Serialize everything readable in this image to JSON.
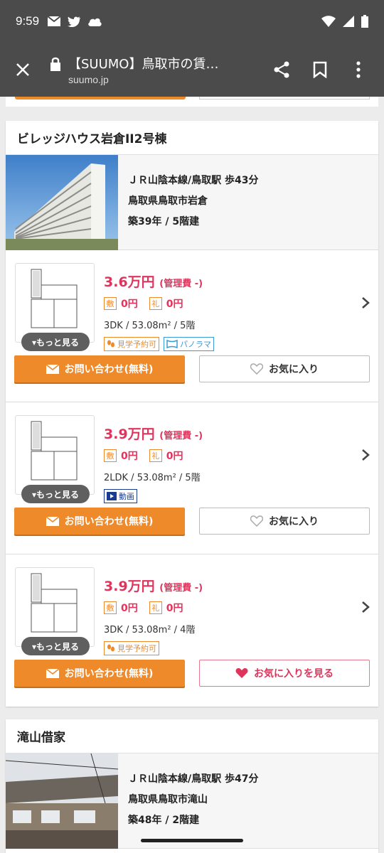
{
  "status": {
    "time": "9:59"
  },
  "browser": {
    "title": "【SUUMO】鳥取市の賃…",
    "url": "suumo.jp"
  },
  "listings": [
    {
      "name": "ビレッジハウス岩倉II2号棟",
      "access": "ＪＲ山陰本線/鳥取駅 歩43分",
      "address": "鳥取県鳥取市岩倉",
      "age": "築39年 / 5階建",
      "units": [
        {
          "rent": "3.6万円",
          "mgmt": "(管理費 -)",
          "deposit_label": "敷",
          "deposit": "0円",
          "key_label": "礼",
          "key_money": "0円",
          "spec": "3DK /  53.08m² /  5階",
          "badges": [
            "見学予約可",
            "パノラマ"
          ],
          "more": "▾もっと見る",
          "inquiry": "お問い合わせ(無料)",
          "fav": "お気に入り"
        },
        {
          "rent": "3.9万円",
          "mgmt": "(管理費 -)",
          "deposit_label": "敷",
          "deposit": "0円",
          "key_label": "礼",
          "key_money": "0円",
          "spec": "2LDK /  53.08m² /  5階",
          "badges": [
            "動画"
          ],
          "more": "▾もっと見る",
          "inquiry": "お問い合わせ(無料)",
          "fav": "お気に入り"
        },
        {
          "rent": "3.9万円",
          "mgmt": "(管理費 -)",
          "deposit_label": "敷",
          "deposit": "0円",
          "key_label": "礼",
          "key_money": "0円",
          "spec": "3DK /  53.08m² /  4階",
          "badges": [
            "見学予約可"
          ],
          "more": "▾もっと見る",
          "inquiry": "お問い合わせ(無料)",
          "fav": "お気に入りを見る"
        }
      ]
    },
    {
      "name": "滝山借家",
      "access": "ＪＲ山陰本線/鳥取駅 歩47分",
      "address": "鳥取県鳥取市滝山",
      "age": "築48年 / 2階建"
    }
  ],
  "colors": {
    "accent": "#ee8a2a",
    "price": "#e0345c",
    "chrome": "#4b4b4b"
  }
}
